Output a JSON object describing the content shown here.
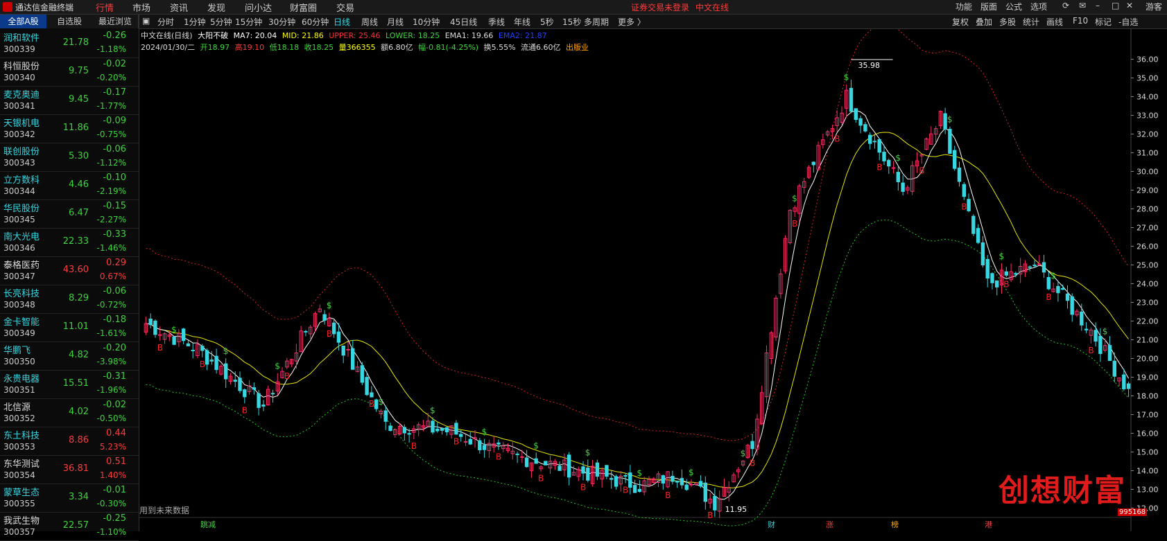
{
  "app": {
    "title": "通达信金融终端",
    "menu": [
      "行情",
      "市场",
      "资讯",
      "发现",
      "问小达",
      "财富圈",
      "交易"
    ],
    "active_menu": "行情",
    "notice": "证券交易未登录",
    "stock_name_top": "中文在线",
    "right_menu": [
      "功能",
      "版面",
      "公式",
      "选项"
    ],
    "user": "游客"
  },
  "sidebar": {
    "tabs": [
      "全部A股",
      "自选股",
      "最近浏览"
    ],
    "stocks": [
      {
        "name": "润和软件",
        "code": "300339",
        "price": "21.78",
        "chg": "-0.26",
        "pct": "-1.18%",
        "dir": "down"
      },
      {
        "name": "科恒股份",
        "code": "300340",
        "price": "9.75",
        "chg": "-0.02",
        "pct": "-0.20%",
        "dir": "down"
      },
      {
        "name": "麦克奥迪",
        "code": "300341",
        "price": "9.45",
        "chg": "-0.17",
        "pct": "-1.77%",
        "dir": "down"
      },
      {
        "name": "天银机电",
        "code": "300342",
        "price": "11.86",
        "chg": "-0.09",
        "pct": "-0.75%",
        "dir": "down"
      },
      {
        "name": "联创股份",
        "code": "300343",
        "price": "5.30",
        "chg": "-0.06",
        "pct": "-1.12%",
        "dir": "down"
      },
      {
        "name": "立方数科",
        "code": "300344",
        "price": "4.46",
        "chg": "-0.10",
        "pct": "-2.19%",
        "dir": "down"
      },
      {
        "name": "华民股份",
        "code": "300345",
        "price": "6.47",
        "chg": "-0.15",
        "pct": "-2.27%",
        "dir": "down"
      },
      {
        "name": "南大光电",
        "code": "300346",
        "price": "22.33",
        "chg": "-0.33",
        "pct": "-1.46%",
        "dir": "down"
      },
      {
        "name": "泰格医药",
        "code": "300347",
        "price": "43.60",
        "chg": "0.29",
        "pct": "0.67%",
        "dir": "up"
      },
      {
        "name": "长亮科技",
        "code": "300348",
        "price": "8.29",
        "chg": "-0.06",
        "pct": "-0.72%",
        "dir": "down"
      },
      {
        "name": "金卡智能",
        "code": "300349",
        "price": "11.01",
        "chg": "-0.18",
        "pct": "-1.61%",
        "dir": "down"
      },
      {
        "name": "华鹏飞",
        "code": "300350",
        "price": "4.82",
        "chg": "-0.20",
        "pct": "-3.98%",
        "dir": "down"
      },
      {
        "name": "永贵电器",
        "code": "300351",
        "price": "15.51",
        "chg": "-0.31",
        "pct": "-1.96%",
        "dir": "down"
      },
      {
        "name": "北信源",
        "code": "300352",
        "price": "4.02",
        "chg": "-0.02",
        "pct": "-0.50%",
        "dir": "down"
      },
      {
        "name": "东土科技",
        "code": "300353",
        "price": "8.86",
        "chg": "0.44",
        "pct": "5.23%",
        "dir": "up"
      },
      {
        "name": "东华测试",
        "code": "300354",
        "price": "36.81",
        "chg": "0.51",
        "pct": "1.40%",
        "dir": "up"
      },
      {
        "name": "蒙草生态",
        "code": "300355",
        "price": "3.34",
        "chg": "-0.01",
        "pct": "-0.30%",
        "dir": "down"
      },
      {
        "name": "我武生物",
        "code": "300357",
        "price": "22.57",
        "chg": "-0.25",
        "pct": "-1.10%",
        "dir": "down"
      }
    ]
  },
  "toolbar": {
    "periods": [
      "分时",
      "1分钟",
      "5分钟",
      "15分钟",
      "30分钟",
      "60分钟",
      "日线",
      "周线",
      "月线",
      "10分钟",
      "45日线",
      "季线",
      "年线",
      "5秒",
      "15秒",
      "多周期",
      "更多 〉"
    ],
    "active_period": "日线",
    "right_tools": [
      "复权",
      "叠加",
      "多股",
      "统计",
      "画线",
      "F10",
      "标记",
      "-自选"
    ]
  },
  "info": {
    "line1": {
      "name": "中文在线(日线)",
      "indicator": "大阳不破",
      "ma7": "MA7: 20.04",
      "mid": "MID: 21.86",
      "upper": "UPPER: 25.46",
      "lower": "LOWER: 18.25",
      "ema1": "EMA1: 19.66",
      "ema2": "EMA2: 21.87"
    },
    "line2": {
      "date": "2024/01/30/二",
      "open": "开18.97",
      "high": "高19.10",
      "low": "低18.18",
      "close": "收18.25",
      "volume": "量366355",
      "amount": "额6.80亿",
      "change": "幅-0.81(-4.25%)",
      "turnover": "换5.55%",
      "float": "流通6.60亿",
      "sector": "出版业"
    }
  },
  "chart_data": {
    "type": "candlestick",
    "y_ticks": [
      "36.00",
      "35.00",
      "34.00",
      "33.00",
      "32.00",
      "31.00",
      "30.00",
      "29.00",
      "28.00",
      "27.00",
      "26.00",
      "25.00",
      "24.00",
      "23.00",
      "22.00",
      "21.00",
      "20.00",
      "19.00",
      "18.00",
      "17.00",
      "16.00",
      "15.00",
      "14.00",
      "13.00",
      "12.00"
    ],
    "ylim": [
      11.5,
      36.5
    ],
    "labels": {
      "high": "35.98",
      "low": "11.95"
    },
    "bottom_label": "用到未来数据",
    "bottom_marks": [
      "跳减",
      "财",
      "涨",
      "榜",
      "港"
    ],
    "up_color": "#ff2a6d",
    "down_color": "#37d6e0",
    "segments": [
      {
        "n": 12,
        "s": 22.0,
        "e": 20.5
      },
      {
        "n": 14,
        "s": 20.5,
        "e": 17.5
      },
      {
        "n": 12,
        "s": 17.5,
        "e": 22.8
      },
      {
        "n": 14,
        "s": 22.8,
        "e": 16.5
      },
      {
        "n": 14,
        "s": 16.5,
        "e": 16.1
      },
      {
        "n": 10,
        "s": 16.1,
        "e": 15.0
      },
      {
        "n": 10,
        "s": 15.0,
        "e": 14.4
      },
      {
        "n": 10,
        "s": 14.4,
        "e": 13.8
      },
      {
        "n": 10,
        "s": 13.8,
        "e": 13.2
      },
      {
        "n": 8,
        "s": 13.2,
        "e": 13.8
      },
      {
        "n": 8,
        "s": 13.8,
        "e": 12.3
      },
      {
        "n": 8,
        "s": 12.3,
        "e": 15.5
      },
      {
        "n": 8,
        "s": 15.5,
        "e": 28.0
      },
      {
        "n": 12,
        "s": 28.0,
        "e": 34.0
      },
      {
        "n": 12,
        "s": 34.0,
        "e": 29.0
      },
      {
        "n": 8,
        "s": 29.0,
        "e": 32.8
      },
      {
        "n": 10,
        "s": 32.8,
        "e": 24.0
      },
      {
        "n": 10,
        "s": 24.0,
        "e": 25.0
      },
      {
        "n": 12,
        "s": 25.0,
        "e": 21.5
      },
      {
        "n": 8,
        "s": 21.5,
        "e": 18.25
      }
    ]
  },
  "watermark": {
    "text": "创想财富",
    "num": "995168"
  }
}
